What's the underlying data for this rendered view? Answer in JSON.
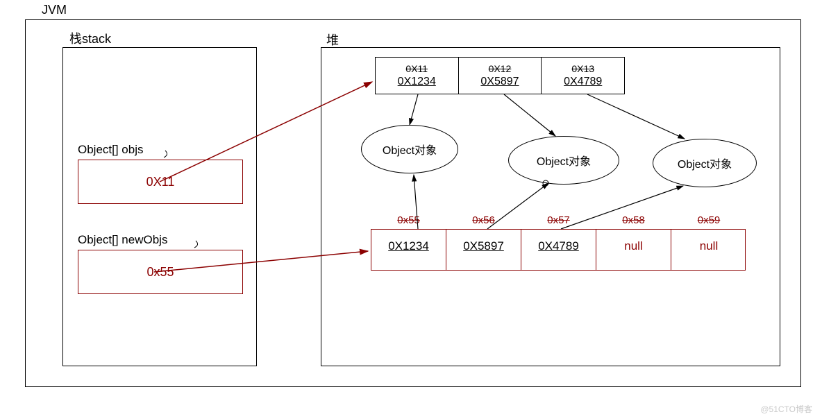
{
  "jvm_label": "JVM",
  "stack_label": "栈stack",
  "heap_label": "堆",
  "stack": {
    "var1": {
      "label": "Object[] objs",
      "value": "0X11"
    },
    "var2": {
      "label": "Object[] newObjs",
      "value": "0x55"
    }
  },
  "array1": {
    "cells": [
      {
        "index": "0X11",
        "value": "0X1234"
      },
      {
        "index": "0X12",
        "value": "0X5897"
      },
      {
        "index": "0X13",
        "value": "0X4789"
      }
    ]
  },
  "objects": {
    "o1": "Object对象",
    "o2": "Object对象",
    "o3": "Object对象"
  },
  "array2": {
    "cells": [
      {
        "index": "0x55",
        "value": "0X1234",
        "null": false
      },
      {
        "index": "0x56",
        "value": "0X5897",
        "null": false
      },
      {
        "index": "0x57",
        "value": "0X4789",
        "null": false
      },
      {
        "index": "0x58",
        "value": "null",
        "null": true
      },
      {
        "index": "0x59",
        "value": "null",
        "null": true
      }
    ]
  },
  "watermark": "@51CTO博客"
}
